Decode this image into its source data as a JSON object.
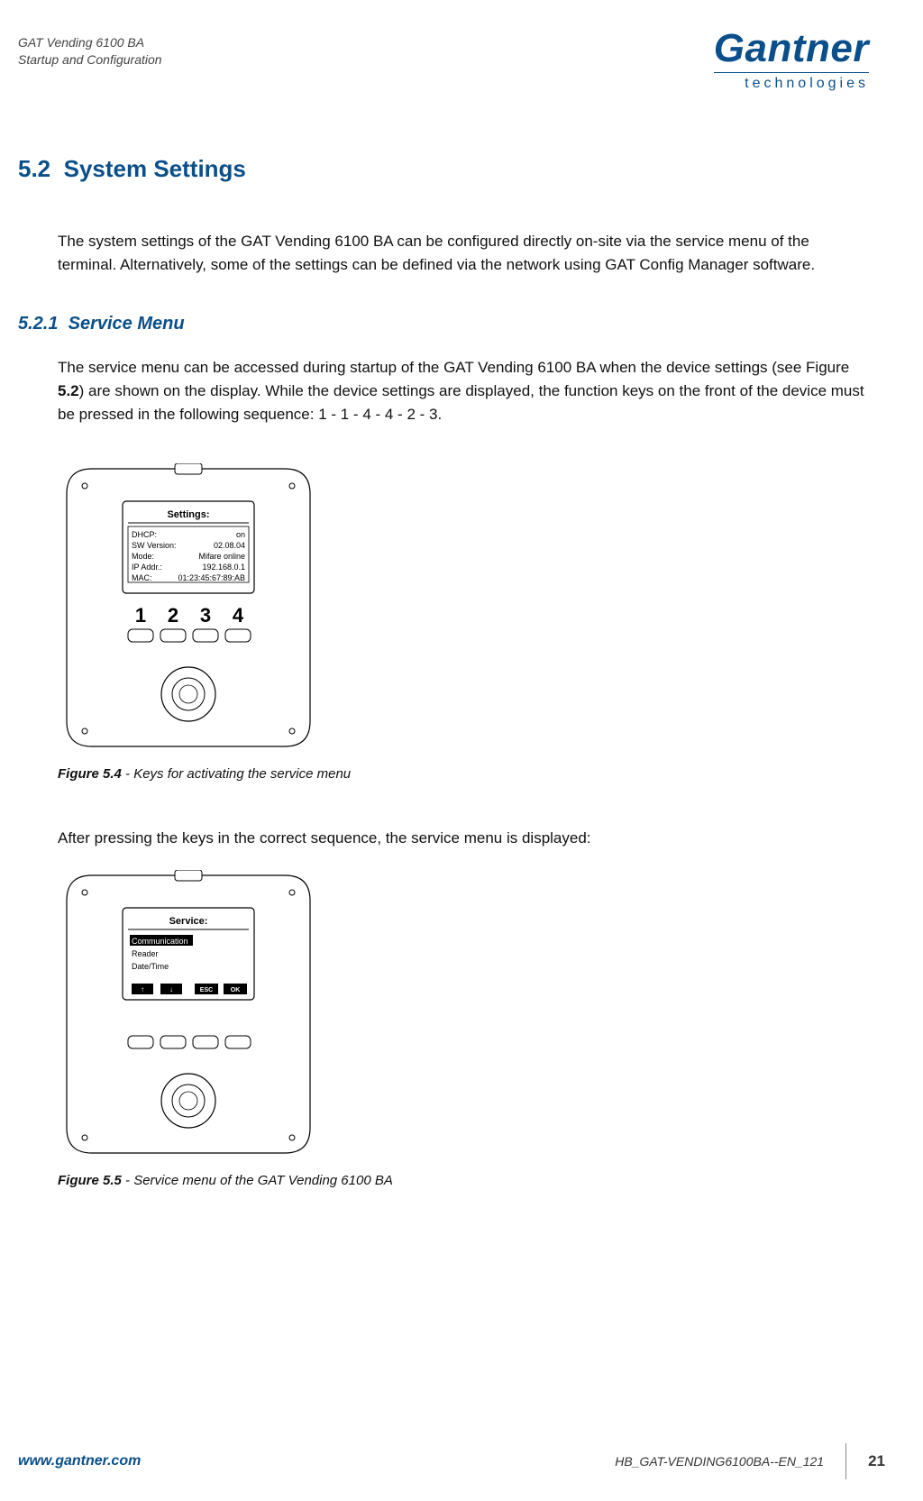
{
  "header": {
    "line1": "GAT Vending 6100 BA",
    "line2": "Startup and Configuration"
  },
  "brand": {
    "main": "Gantner",
    "sub": "technologies"
  },
  "section": {
    "num": "5.2",
    "title": "System Settings",
    "intro": "The system settings of the GAT Vending 6100 BA can be configured directly on-site via the service menu of the terminal. Alternatively, some of the settings can be defined via the network using GAT Config Manager software."
  },
  "sub": {
    "num": "5.2.1",
    "title": "Service Menu",
    "para_before_ref": "The service menu can be accessed during startup of the GAT Vending 6100 BA when the device settings (see Figure ",
    "ref": "5.2",
    "para_after_ref": ") are shown on the display. While the device settings are displayed, the function keys on the front of the device must be pressed in the following sequence: 1 - 1 - 4 - 4 - 2 - 3."
  },
  "fig54": {
    "label": "Figure 5.4",
    "caption": " - Keys for activating the service menu",
    "screen_title": "Settings:",
    "rows": [
      {
        "k": "DHCP:",
        "v": "on"
      },
      {
        "k": "SW Version:",
        "v": "02.08.04"
      },
      {
        "k": "Mode:",
        "v": "Mifare online"
      },
      {
        "k": "IP Addr.:",
        "v": "192.168.0.1"
      },
      {
        "k": "MAC:",
        "v": "01:23:45:67:89:AB"
      }
    ],
    "keys": [
      "1",
      "2",
      "3",
      "4"
    ]
  },
  "mid_para": "After pressing the keys in the correct sequence, the service menu is displayed:",
  "fig55": {
    "label": "Figure 5.5",
    "caption": " - Service menu of the GAT Vending 6100 BA",
    "screen_title": "Service:",
    "items": [
      "Communication",
      "Reader",
      "Date/Time"
    ],
    "softkeys": [
      "↑",
      "↓",
      "ESC",
      "OK"
    ]
  },
  "footer": {
    "url": "www.gantner.com",
    "doc": "HB_GAT-VENDING6100BA--EN_121",
    "page": "21"
  }
}
